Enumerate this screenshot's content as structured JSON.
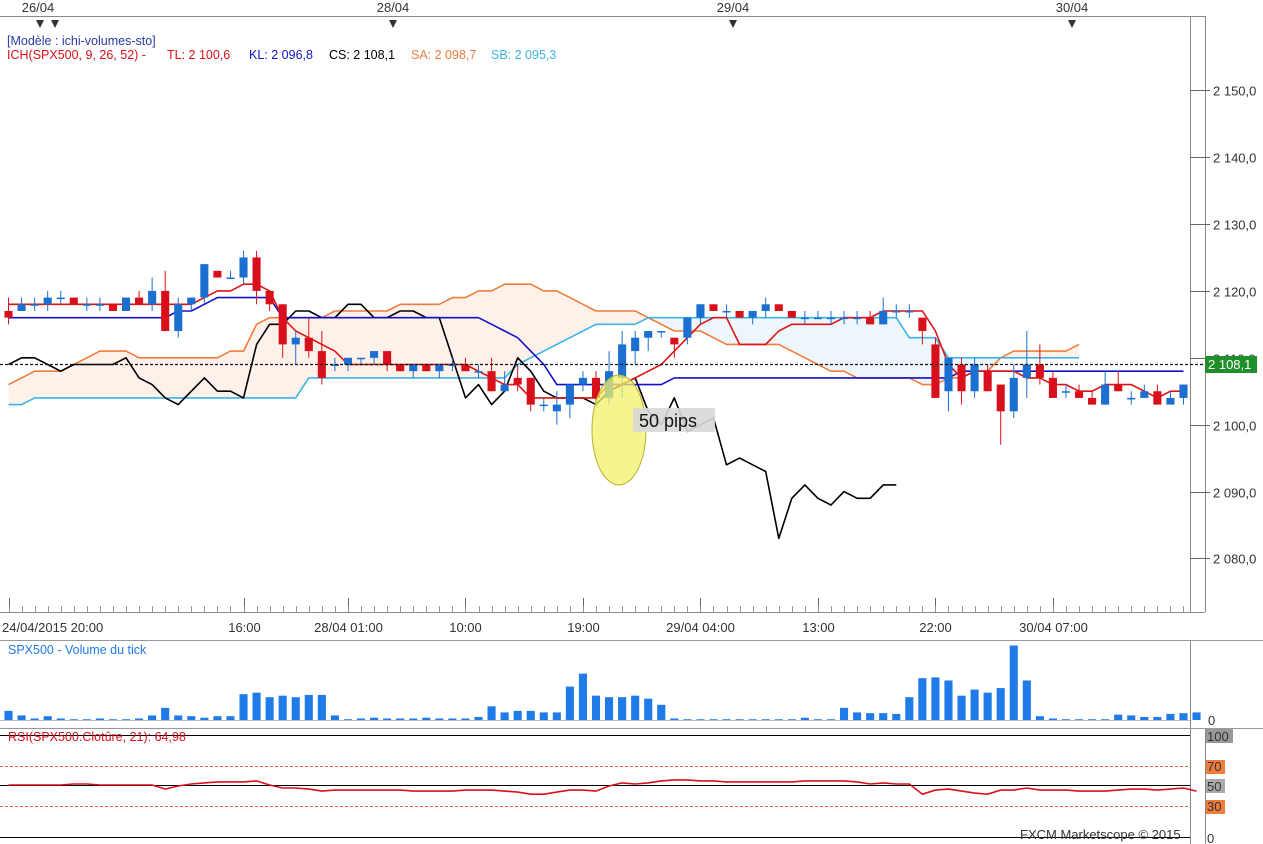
{
  "header_dates": [
    "26/04",
    "28/04",
    "29/04",
    "30/04"
  ],
  "legend": {
    "model": "[Modèle : ichi-volumes-sto]",
    "ich_label": "ICH(SPX500, 9, 26, 52) -",
    "tl": "TL: 2 100,6",
    "kl": "KL: 2 096,8",
    "cs": "CS: 2 108,1",
    "sa": "SA: 2 098,7",
    "sb": "SB: 2 095,3"
  },
  "colors": {
    "up": "#1a6fd1",
    "down": "#d8101b",
    "tenkan": "#e01212",
    "kijun": "#1212c8",
    "chikou": "#000000",
    "senkou_a": "#f07c3c",
    "senkou_b": "#3cb4e6",
    "volume": "#1e7be8",
    "rsi": "#d8101b",
    "price_tag": "#1f8f2a"
  },
  "price_tag": "2 108,1",
  "annotation": "50 pips",
  "volume_panel": {
    "title": "SPX500 - Volume du tick",
    "zero_label": "0"
  },
  "rsi_panel": {
    "title": "RSI(SPX500.Clotûre, 21): 64,98",
    "levels": [
      "100",
      "70",
      "50",
      "30",
      "0"
    ]
  },
  "copyright": "FXCM Marketscope © 2015",
  "chart_data": {
    "type": "candlestick",
    "y_ticks": [
      "2 080,0",
      "2 090,0",
      "2 100,0",
      "2 110,0",
      "2 120,0",
      "2 130,0",
      "2 140,0",
      "2 150,0"
    ],
    "ylim": [
      2072,
      2159
    ],
    "x_tick_labels": [
      "24/04/2015 20:00",
      "16:00",
      "28/04 01:00",
      "10:00",
      "19:00",
      "29/04 04:00",
      "13:00",
      "22:00",
      "30/04 07:00"
    ],
    "candles": [
      [
        2117,
        2119,
        2115,
        2116
      ],
      [
        2117,
        2119,
        2117,
        2118
      ],
      [
        2118,
        2119,
        2117,
        2118
      ],
      [
        2118,
        2120,
        2117,
        2119
      ],
      [
        2119,
        2120,
        2118,
        2119
      ],
      [
        2119,
        2119,
        2118,
        2118
      ],
      [
        2118,
        2119,
        2117,
        2118
      ],
      [
        2118,
        2119,
        2117,
        2118
      ],
      [
        2118,
        2118,
        2117,
        2117
      ],
      [
        2117,
        2119,
        2117,
        2119
      ],
      [
        2119,
        2120,
        2118,
        2118
      ],
      [
        2118,
        2122,
        2117,
        2120
      ],
      [
        2120,
        2123,
        2114,
        2114
      ],
      [
        2114,
        2119,
        2113,
        2118
      ],
      [
        2118,
        2119,
        2117,
        2119
      ],
      [
        2119,
        2124,
        2118,
        2124
      ],
      [
        2123,
        2123,
        2122,
        2122
      ],
      [
        2122,
        2123,
        2122,
        2122
      ],
      [
        2122,
        2126,
        2121,
        2125
      ],
      [
        2125,
        2126,
        2118,
        2120
      ],
      [
        2120,
        2119,
        2117,
        2118
      ],
      [
        2118,
        2118,
        2110,
        2112
      ],
      [
        2112,
        2114,
        2109,
        2113
      ],
      [
        2113,
        2116,
        2110,
        2111
      ],
      [
        2111,
        2114,
        2106,
        2107
      ],
      [
        2109,
        2110,
        2108,
        2109
      ],
      [
        2109,
        2110,
        2108,
        2110
      ],
      [
        2110,
        2110,
        2109,
        2110
      ],
      [
        2110,
        2111,
        2109,
        2111
      ],
      [
        2111,
        2111,
        2108,
        2109
      ],
      [
        2109,
        2109,
        2108,
        2108
      ],
      [
        2108,
        2109,
        2107,
        2109
      ],
      [
        2109,
        2109,
        2108,
        2108
      ],
      [
        2108,
        2109,
        2107,
        2109
      ],
      [
        2109,
        2110,
        2108,
        2109
      ],
      [
        2109,
        2110,
        2108,
        2108
      ],
      [
        2108,
        2109,
        2107,
        2108
      ],
      [
        2108,
        2110,
        2105,
        2105
      ],
      [
        2105,
        2108,
        2105,
        2106
      ],
      [
        2107,
        2109,
        2105,
        2106
      ],
      [
        2107,
        2107,
        2102,
        2103
      ],
      [
        2103,
        2104,
        2102,
        2103
      ],
      [
        2102,
        2105,
        2100,
        2103
      ],
      [
        2103,
        2106,
        2101,
        2106
      ],
      [
        2106,
        2108,
        2105,
        2107
      ],
      [
        2107,
        2108,
        2103,
        2104
      ],
      [
        2104,
        2111,
        2103,
        2108
      ],
      [
        2107,
        2114,
        2104,
        2112
      ],
      [
        2111,
        2114,
        2109,
        2113
      ],
      [
        2113,
        2114,
        2111,
        2114
      ],
      [
        2114,
        2114,
        2113,
        2114
      ],
      [
        2113,
        2113,
        2110,
        2112
      ],
      [
        2113,
        2116,
        2112,
        2116
      ],
      [
        2116,
        2118,
        2115,
        2118
      ],
      [
        2118,
        2118,
        2117,
        2117
      ],
      [
        2117,
        2118,
        2116,
        2117
      ],
      [
        2117,
        2117,
        2116,
        2116
      ],
      [
        2116,
        2117,
        2115,
        2117
      ],
      [
        2117,
        2119,
        2116,
        2118
      ],
      [
        2118,
        2118,
        2117,
        2117
      ],
      [
        2117,
        2117,
        2116,
        2116
      ],
      [
        2116,
        2117,
        2115,
        2116
      ],
      [
        2116,
        2117,
        2116,
        2116
      ],
      [
        2116,
        2117,
        2115,
        2116
      ],
      [
        2116,
        2117,
        2115,
        2116
      ],
      [
        2116,
        2117,
        2115,
        2116
      ],
      [
        2116,
        2117,
        2115,
        2115
      ],
      [
        2115,
        2119,
        2115,
        2117
      ],
      [
        2117,
        2118,
        2116,
        2117
      ],
      [
        2117,
        2118,
        2116,
        2117
      ],
      [
        2116,
        2116,
        2112,
        2114
      ],
      [
        2112,
        2113,
        2104,
        2104
      ],
      [
        2105,
        2110,
        2102,
        2110
      ],
      [
        2109,
        2110,
        2103,
        2105
      ],
      [
        2105,
        2110,
        2104,
        2109
      ],
      [
        2108,
        2109,
        2105,
        2105
      ],
      [
        2106,
        2106,
        2097,
        2102
      ],
      [
        2102,
        2109,
        2101,
        2107
      ],
      [
        2107,
        2114,
        2104,
        2109
      ],
      [
        2109,
        2112,
        2106,
        2107
      ],
      [
        2107,
        2108,
        2104,
        2104
      ],
      [
        2105,
        2106,
        2104,
        2105
      ],
      [
        2105,
        2106,
        2104,
        2104
      ],
      [
        2104,
        2105,
        2103,
        2103
      ],
      [
        2103,
        2108,
        2103,
        2106
      ],
      [
        2106,
        2108,
        2105,
        2105
      ],
      [
        2104,
        2105,
        2103,
        2104
      ],
      [
        2104,
        2106,
        2104,
        2105
      ],
      [
        2105,
        2106,
        2103,
        2103
      ],
      [
        2103,
        2105,
        2103,
        2104
      ],
      [
        2104,
        2106,
        2103,
        2106
      ]
    ],
    "tenkan": [
      2118,
      2118,
      2118,
      2118,
      2118,
      2118,
      2118,
      2118,
      2118,
      2118,
      2118,
      2118,
      2118,
      2118,
      2118,
      2119,
      2120,
      2120,
      2121,
      2121,
      2120,
      2116,
      2114,
      2113,
      2112,
      2111,
      2109,
      2109,
      2109,
      2109,
      2109,
      2109,
      2109,
      2109,
      2109,
      2109,
      2108,
      2107,
      2106,
      2106,
      2104,
      2104,
      2104,
      2104,
      2104,
      2104,
      2106,
      2106,
      2107,
      2108,
      2109,
      2111,
      2113,
      2115,
      2116,
      2116,
      2112,
      2112,
      2112,
      2114,
      2115,
      2115,
      2115,
      2115,
      2116,
      2116,
      2116,
      2117,
      2117,
      2117,
      2117,
      2114,
      2109,
      2107,
      2108,
      2108,
      2108,
      2108,
      2107,
      2107,
      2106,
      2106,
      2105,
      2105,
      2106,
      2106,
      2106,
      2105,
      2104,
      2105,
      2105
    ],
    "kijun": [
      2116,
      2116,
      2116,
      2116,
      2116,
      2116,
      2116,
      2116,
      2116,
      2116,
      2116,
      2116,
      2116,
      2117,
      2117,
      2118,
      2119,
      2119,
      2119,
      2119,
      2119,
      2116,
      2116,
      2116,
      2116,
      2116,
      2116,
      2116,
      2116,
      2116,
      2116,
      2116,
      2116,
      2116,
      2116,
      2116,
      2116,
      2115,
      2114,
      2113,
      2111,
      2109,
      2106,
      2106,
      2106,
      2106,
      2106,
      2106,
      2106,
      2106,
      2106,
      2107,
      2107,
      2107,
      2107,
      2107,
      2107,
      2107,
      2107,
      2107,
      2107,
      2107,
      2107,
      2107,
      2107,
      2107,
      2107,
      2107,
      2107,
      2107,
      2107,
      2107,
      2107,
      2108,
      2108,
      2108,
      2108,
      2108,
      2108,
      2108,
      2108,
      2108,
      2108,
      2108,
      2108,
      2108,
      2108,
      2108,
      2108,
      2108,
      2108
    ],
    "chikou": [
      2109,
      2110,
      2110,
      2109,
      2108,
      2109,
      2109,
      2109,
      2109,
      2110,
      2107,
      2106,
      2104,
      2103,
      2105,
      2107,
      2105,
      2105,
      2104,
      2112,
      2115,
      2115,
      2117,
      2117,
      2116,
      2116,
      2118,
      2118,
      2116,
      2116,
      2117,
      2117,
      2116,
      2116,
      2110,
      2104,
      2106,
      2103,
      2105,
      2110,
      2108,
      2105,
      2104,
      2104,
      2104,
      2103,
      2105,
      2106,
      2107,
      2102,
      2100,
      2104,
      2099,
      2100,
      2101,
      2094,
      2095,
      2094,
      2093,
      2083,
      2089,
      2091,
      2089,
      2088,
      2090,
      2089,
      2089,
      2091,
      2091
    ],
    "senkou_a": [
      2106,
      2107,
      2108,
      2108,
      2108,
      2109,
      2110,
      2111,
      2111,
      2111,
      2110,
      2110,
      2110,
      2110,
      2110,
      2110,
      2110,
      2111,
      2111,
      2115,
      2116,
      2116,
      2116,
      2116,
      2116,
      2117,
      2117,
      2117,
      2117,
      2117,
      2118,
      2118,
      2118,
      2118,
      2119,
      2119,
      2120,
      2120,
      2121,
      2121,
      2121,
      2120,
      2120,
      2119,
      2118,
      2117,
      2117,
      2117,
      2117,
      2116,
      2115,
      2114,
      2114,
      2114,
      2113,
      2112,
      2112,
      2112,
      2112,
      2112,
      2111,
      2110,
      2109,
      2108,
      2108,
      2107,
      2107,
      2107,
      2107,
      2107,
      2106,
      2106,
      2107,
      2107,
      2108,
      2108,
      2110,
      2111,
      2111,
      2111,
      2111,
      2111,
      2112
    ],
    "senkou_b": [
      2103,
      2103,
      2104,
      2104,
      2104,
      2104,
      2104,
      2104,
      2104,
      2104,
      2104,
      2104,
      2104,
      2104,
      2104,
      2104,
      2104,
      2104,
      2104,
      2104,
      2104,
      2104,
      2104,
      2107,
      2107,
      2107,
      2107,
      2107,
      2107,
      2107,
      2107,
      2107,
      2107,
      2107,
      2107,
      2107,
      2107,
      2107,
      2107,
      2109,
      2110,
      2111,
      2112,
      2113,
      2114,
      2115,
      2115,
      2115,
      2115,
      2116,
      2116,
      2116,
      2116,
      2116,
      2116,
      2116,
      2116,
      2116,
      2116,
      2116,
      2116,
      2116,
      2116,
      2116,
      2116,
      2116,
      2116,
      2116,
      2116,
      2113,
      2113,
      2113,
      2110,
      2110,
      2110,
      2110,
      2110,
      2110,
      2110,
      2110,
      2110,
      2110,
      2110
    ],
    "volume": [
      12,
      6,
      2,
      5,
      2,
      1,
      1,
      2,
      1,
      1,
      2,
      6,
      16,
      6,
      5,
      3,
      5,
      5,
      34,
      36,
      30,
      32,
      30,
      33,
      33,
      6,
      1,
      2,
      3,
      2,
      2,
      2,
      3,
      2,
      2,
      2,
      4,
      18,
      10,
      12,
      12,
      10,
      10,
      44,
      61,
      32,
      30,
      30,
      32,
      28,
      20,
      2,
      1,
      1,
      1,
      1,
      1,
      1,
      1,
      1,
      1,
      3,
      1,
      1,
      16,
      10,
      9,
      9,
      8,
      30,
      55,
      56,
      52,
      32,
      40,
      36,
      42,
      98,
      52,
      5,
      2,
      1,
      1,
      1,
      1,
      7,
      6,
      4,
      4,
      8,
      9,
      10
    ],
    "volume_ylim": [
      0,
      100
    ],
    "rsi": [
      51,
      51,
      51,
      51,
      51,
      52,
      52,
      51,
      51,
      51,
      51,
      51,
      47,
      50,
      52,
      53,
      54,
      54,
      54,
      55,
      51,
      48,
      48,
      47,
      45,
      46,
      46,
      46,
      46,
      46,
      46,
      45,
      45,
      45,
      45,
      46,
      46,
      46,
      45,
      44,
      42,
      42,
      44,
      46,
      46,
      45,
      50,
      53,
      52,
      53,
      55,
      56,
      56,
      55,
      55,
      54,
      54,
      54,
      54,
      54,
      54,
      55,
      55,
      55,
      55,
      54,
      52,
      53,
      52,
      52,
      42,
      46,
      47,
      45,
      43,
      42,
      46,
      46,
      48,
      46,
      46,
      46,
      45,
      45,
      45,
      46,
      47,
      47,
      46,
      47,
      48,
      45
    ],
    "rsi_ylim": [
      0,
      100
    ]
  }
}
